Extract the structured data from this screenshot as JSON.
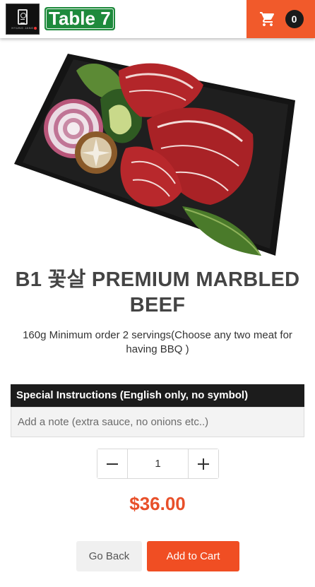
{
  "header": {
    "logo_text": "HYUNG JANG",
    "table_label": "Table 7",
    "cart_count": "0"
  },
  "product": {
    "title": "B1 꽃살 PREMIUM MARBLED BEEF",
    "description": "160g Minimum order 2 servings(Choose any two meat for having BBQ )",
    "price": "$36.00"
  },
  "instructions": {
    "label": "Special Instructions (English only, no symbol)",
    "placeholder": "Add a note (extra sauce, no onions etc..)",
    "value": ""
  },
  "quantity": {
    "value": "1",
    "minus_symbol": "—",
    "plus_symbol": "+"
  },
  "actions": {
    "back_label": "Go Back",
    "add_label": "Add to Cart"
  },
  "colors": {
    "accent": "#f04e23",
    "table_badge": "#1e8a3c",
    "price": "#e8502a",
    "instruction_bar": "#1c1c1c"
  },
  "icons": {
    "cart": "shopping-cart-icon",
    "minus": "minus-icon",
    "plus": "plus-icon"
  }
}
